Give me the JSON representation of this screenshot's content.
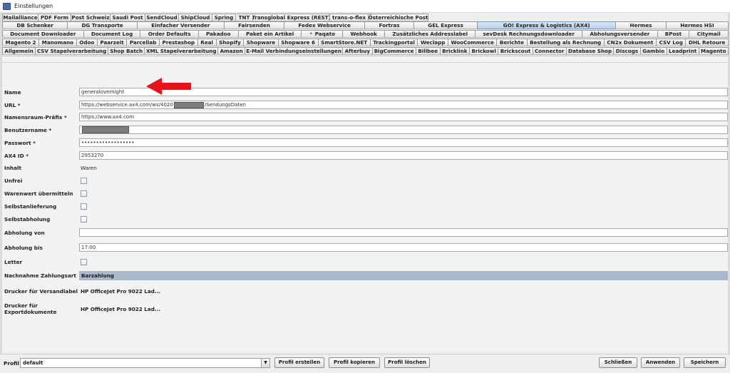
{
  "window": {
    "title": "Einstellungen"
  },
  "tabs": {
    "row1": [
      "Mailalliance",
      "PDF Form",
      "Post Schweiz",
      "Saudi Post",
      "SendCloud",
      "ShipCloud",
      "Spring",
      "TNT",
      "Transglobal Express (REST)",
      "trans-o-flex",
      "Österreichische Post"
    ],
    "row2": [
      "DB Schenker",
      "DG Transporte",
      "Einfacher Versender",
      "Fairsenden",
      "Fedex Webservice",
      "Fortras",
      "GEL Express",
      "GO! Express & Logistics (AX4)",
      "Hermes",
      "Hermes HSI"
    ],
    "row3": [
      "Document Downloader",
      "Document Log",
      "Order Defaults",
      "Pakadoo",
      "Paket ein Artikel",
      "Paqato",
      "Webhook",
      "Zusätzliches Addresslabel",
      "sevDesk Rechnungsdownloader",
      "Abholungsversender",
      "BPost",
      "Citymail"
    ],
    "row4": [
      "Magento 2",
      "Manomano",
      "Odoo",
      "Paarzeit",
      "Parcellab",
      "Prestashop",
      "Real",
      "Shopify",
      "Shopware",
      "Shopware 6",
      "SmartStore.NET",
      "Trackingportal",
      "Weclapp",
      "WooCommerce",
      "Berichte",
      "Bestellung als Rechnung",
      "CN2x Dokument",
      "CSV Log",
      "DHL Retoure"
    ],
    "row5": [
      "Allgemein",
      "CSV Stapelverarbeitung",
      "Shop Batch",
      "XML Stapelverarbeitung",
      "Amazon",
      "E-Mail Verbindungseinstellungen",
      "Afterbuy",
      "BigCommerce",
      "Billbee",
      "Bricklink",
      "Brickowl",
      "Brickscout",
      "Connector",
      "Database Shop",
      "Discogs",
      "Gambio",
      "Leadprint",
      "Magento"
    ],
    "active": "GO! Express & Logistics (AX4)"
  },
  "form": {
    "name": {
      "label": "Name",
      "value": "generalovernight"
    },
    "url": {
      "label": "URL *",
      "prefix": "https://webservice.ax4.com/ws/4020",
      "suffix": "/SendungsDaten"
    },
    "namespace": {
      "label": "Namensraum-Präfix *",
      "value": "https://www.ax4.com"
    },
    "username": {
      "label": "Benutzername *"
    },
    "password": {
      "label": "Passwort *",
      "value": "••••••••••••••••••"
    },
    "ax4id": {
      "label": "AX4 ID *",
      "value": "2953270"
    },
    "inhalt": {
      "label": "Inhalt",
      "value": "Waren"
    },
    "unfrei": {
      "label": "Unfrei",
      "checked": false
    },
    "warenwert": {
      "label": "Warenwert übermitteln",
      "checked": false
    },
    "selbstanlieferung": {
      "label": "Selbstanlieferung",
      "checked": false
    },
    "selbstabholung": {
      "label": "Selbstabholung",
      "checked": false
    },
    "abholung_von": {
      "label": "Abholung von",
      "value": ""
    },
    "abholung_bis": {
      "label": "Abholung bis",
      "value": "17:00"
    },
    "letter": {
      "label": "Letter",
      "checked": false
    },
    "nachnahme": {
      "label": "Nachnahme Zahlungsart",
      "value": "Barzahlung"
    },
    "drucker_versand": {
      "label": "Drucker für Versandlabel",
      "value": "HP OfficeJet Pro 9022 Lad..."
    },
    "drucker_export": {
      "label_line1": "Drucker für",
      "label_line2": "Exportdokumente",
      "value": "HP OfficeJet Pro 9022 Lad..."
    }
  },
  "footer": {
    "profile_label": "Profil",
    "profile_value": "default",
    "create": "Profil erstellen",
    "copy": "Profil kopieren",
    "delete": "Profil löschen",
    "close": "Schließen",
    "apply": "Anwenden",
    "save": "Speichern"
  },
  "colors": {
    "annotation_arrow": "#e8121b",
    "active_tab": "#b9d1ea",
    "select_bar": "#a9b9cb"
  }
}
